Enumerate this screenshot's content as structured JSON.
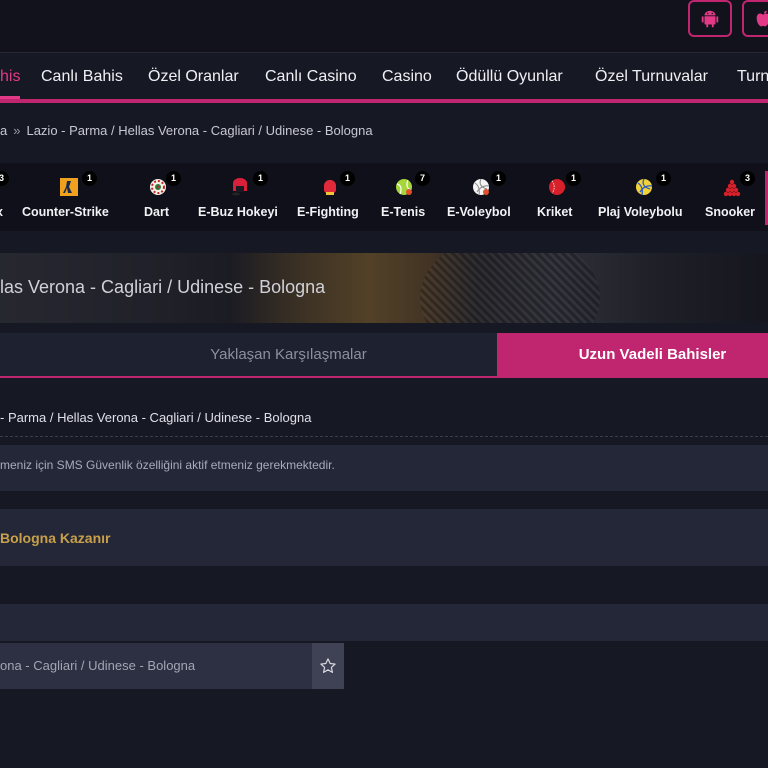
{
  "nav": {
    "items": [
      {
        "label": "his",
        "active": true
      },
      {
        "label": "Canlı Bahis"
      },
      {
        "label": "Özel Oranlar"
      },
      {
        "label": "Canlı Casino"
      },
      {
        "label": "Casino"
      },
      {
        "label": "Ödüllü Oyunlar"
      },
      {
        "label": "Özel Turnuvalar"
      },
      {
        "label": "Turn"
      }
    ]
  },
  "app_buttons": [
    {
      "icon": "android-icon"
    },
    {
      "icon": "apple-icon"
    }
  ],
  "breadcrumb": {
    "prev": "a",
    "separator": "»",
    "current": "Lazio - Parma / Hellas Verona - Cagliari / Udinese - Bologna"
  },
  "sports": [
    {
      "label": "x",
      "count": "3",
      "icon": "x-icon"
    },
    {
      "label": "Counter-Strike",
      "count": "1",
      "icon": "counter-strike-icon"
    },
    {
      "label": "Dart",
      "count": "1",
      "icon": "dartboard-icon"
    },
    {
      "label": "E-Buz Hokeyi",
      "count": "1",
      "icon": "ice-hockey-icon"
    },
    {
      "label": "E-Fighting",
      "count": "1",
      "icon": "boxing-glove-icon"
    },
    {
      "label": "E-Tenis",
      "count": "7",
      "icon": "tennis-ball-icon"
    },
    {
      "label": "E-Voleybol",
      "count": "1",
      "icon": "volleyball-icon"
    },
    {
      "label": "Kriket",
      "count": "1",
      "icon": "cricket-ball-icon"
    },
    {
      "label": "Plaj Voleybolu",
      "count": "1",
      "icon": "beach-volleyball-icon"
    },
    {
      "label": "Snooker",
      "count": "3",
      "icon": "snooker-icon"
    }
  ],
  "banner": {
    "title": "las Verona - Cagliari / Udinese - Bologna"
  },
  "tabs": {
    "upcoming": "Yaklaşan Karşılaşmalar",
    "longterm": "Uzun Vadeli Bahisler"
  },
  "event": {
    "title": "- Parma / Hellas Verona - Cagliari / Udinese - Bologna"
  },
  "notice": {
    "text": "meniz için SMS Güvenlik özelliğini aktif etmeniz gerekmektedir."
  },
  "market": {
    "title": "Bologna Kazanır"
  },
  "odd": {
    "text": "ona - Cagliari / Udinese - Bologna",
    "fav_icon": "star-icon"
  },
  "colors": {
    "accent": "#c0266f",
    "gold": "#c9a04a"
  }
}
